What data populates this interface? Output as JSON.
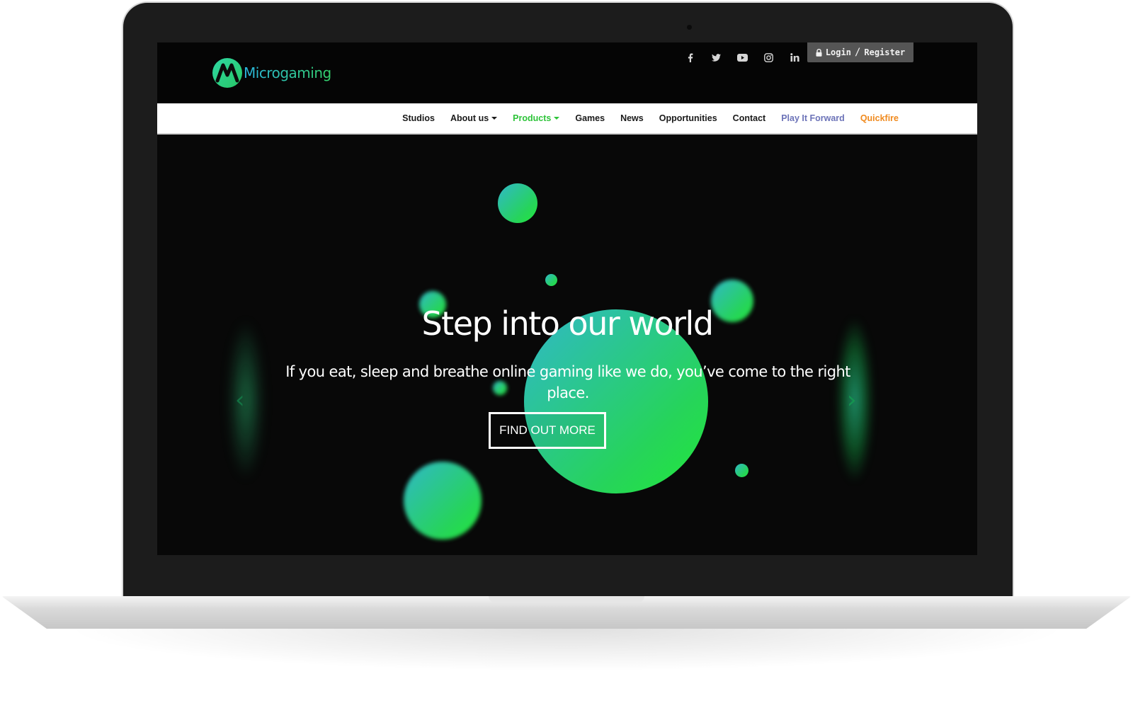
{
  "brand": {
    "name": "Microgaming"
  },
  "header": {
    "social": [
      {
        "icon": "facebook-icon",
        "glyph": "f"
      },
      {
        "icon": "twitter-icon",
        "glyph": "🐦"
      },
      {
        "icon": "youtube-icon",
        "glyph": "▶"
      },
      {
        "icon": "instagram-icon",
        "glyph": "◎"
      },
      {
        "icon": "linkedin-icon",
        "glyph": "in"
      }
    ],
    "login": {
      "icon": "lock-icon",
      "login_label": "Login",
      "separator": "/",
      "register_label": "Register"
    }
  },
  "nav": {
    "items": [
      {
        "label": "Studios"
      },
      {
        "label": "About us",
        "dropdown": true
      },
      {
        "label": "Products",
        "dropdown": true,
        "active": true
      },
      {
        "label": "Games"
      },
      {
        "label": "News"
      },
      {
        "label": "Opportunities"
      },
      {
        "label": "Contact"
      },
      {
        "label": "Play It Forward"
      },
      {
        "label": "Quickfire"
      }
    ]
  },
  "hero": {
    "title": "Step into our world",
    "subtitle": "If you eat, sleep and breathe online gaming like we do, you’ve come to the right place.",
    "cta_label": "FIND OUT MORE",
    "prev_icon": "chevron-left-icon",
    "next_icon": "chevron-right-icon"
  },
  "colors": {
    "accent_green": "#2ec43a",
    "accent_blue": "#2ab5e0",
    "play_it_forward": "#6c73b8",
    "quickfire": "#f08a1e",
    "login_bg": "#555555"
  }
}
